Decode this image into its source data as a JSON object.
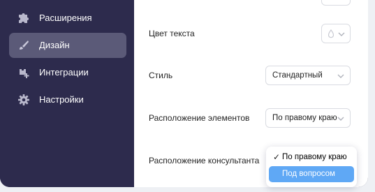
{
  "sidebar": {
    "items": [
      {
        "label": "Расширения",
        "icon": "puzzle-icon"
      },
      {
        "label": "Дизайн",
        "icon": "brush-icon",
        "active": true
      },
      {
        "label": "Интеграции",
        "icon": "integrations-icon"
      },
      {
        "label": "Настройки",
        "icon": "gear-icon"
      }
    ]
  },
  "settings": {
    "text_color": {
      "label": "Цвет текста",
      "icon": "droplet-icon"
    },
    "style": {
      "label": "Стиль",
      "value": "Стандартный"
    },
    "elements_position": {
      "label": "Расположение элементов",
      "value": "По правому краю"
    },
    "consultant_position": {
      "label": "Расположение консультанта",
      "options": [
        {
          "label": "По правому краю",
          "selected": true
        },
        {
          "label": "Под вопросом",
          "highlighted": true
        }
      ]
    }
  },
  "colors": {
    "sidebar_bg": "#2d2b4d",
    "active_item_bg": "#5b5a78",
    "highlight": "#5fa8f5"
  }
}
